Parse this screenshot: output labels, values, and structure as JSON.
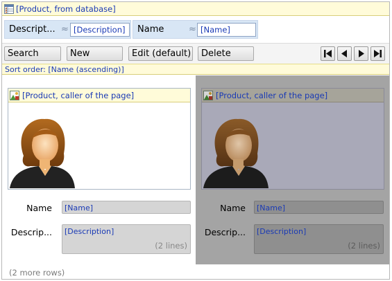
{
  "title": "[Product, from database]",
  "filters": [
    {
      "label": "Descript...",
      "approx": "≈",
      "value": "[Description]"
    },
    {
      "label": "Name",
      "approx": "≈",
      "value": "[Name]"
    }
  ],
  "toolbar": {
    "search_label": "Search",
    "new_label": "New",
    "edit_label": "Edit (default)",
    "delete_label": "Delete"
  },
  "sort_order": "Sort order: [Name (ascending)]",
  "cards": [
    {
      "image_header": "[Product, caller of the page]",
      "name_label": "Name",
      "name_value": "[Name]",
      "desc_label": "Descrip...",
      "desc_value": "[Description]",
      "desc_lines": "(2 lines)",
      "selected": false
    },
    {
      "image_header": "[Product, caller of the page]",
      "name_label": "Name",
      "name_value": "[Name]",
      "desc_label": "Descrip...",
      "desc_value": "[Description]",
      "desc_lines": "(2 lines)",
      "selected": true
    }
  ],
  "more_rows": "(2 more rows)",
  "icons": [
    "table-icon",
    "image-field-icon",
    "first-record-icon",
    "previous-record-icon",
    "next-record-icon",
    "last-record-icon",
    "person-avatar-icon"
  ],
  "colors": {
    "link": "#1a3ab5",
    "header_bg": "#fffbd9",
    "filter_bg": "#d8e6f5",
    "selected_bg": "#a4a4a4"
  }
}
